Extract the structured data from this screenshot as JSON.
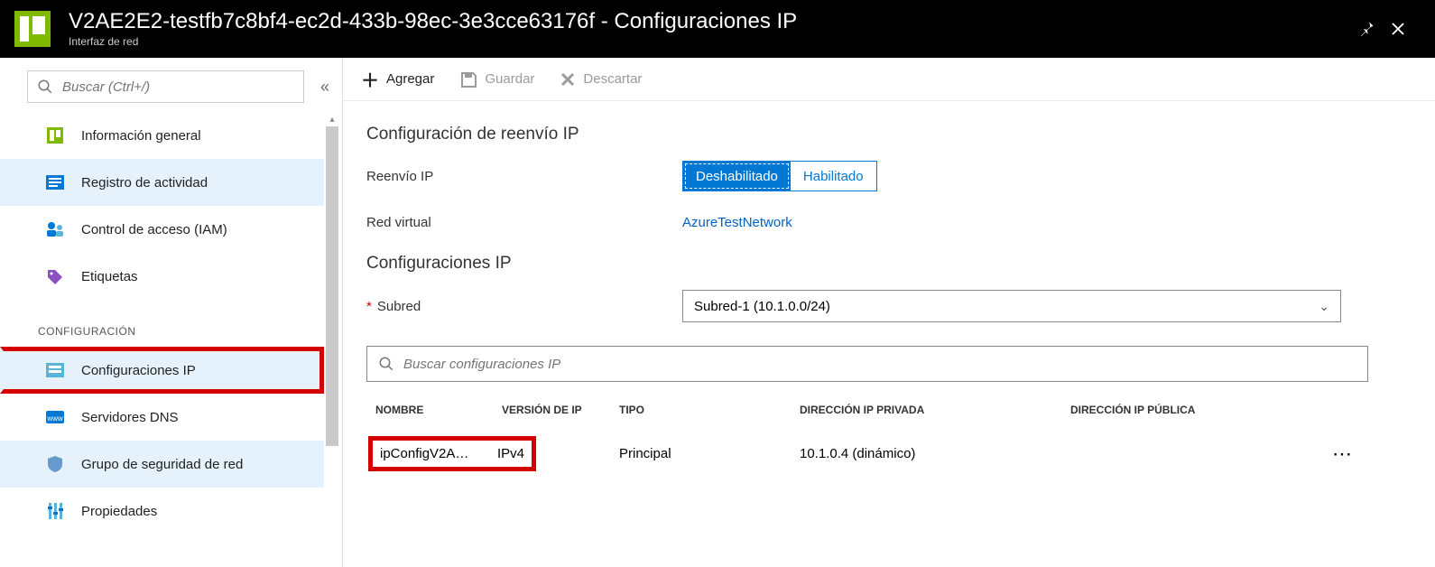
{
  "header": {
    "title": "V2AE2E2-testfb7c8bf4-ec2d-433b-98ec-3e3cce63176f - Configuraciones IP",
    "subtitle": "Interfaz de red"
  },
  "sidebar": {
    "search_placeholder": "Buscar (Ctrl+/)",
    "items_top": [
      {
        "label": "Información general"
      },
      {
        "label": "Registro de actividad"
      },
      {
        "label": "Control de acceso (IAM)"
      },
      {
        "label": "Etiquetas"
      }
    ],
    "section_label": "CONFIGURACIÓN",
    "items_cfg": [
      {
        "label": "Configuraciones IP"
      },
      {
        "label": "Servidores DNS"
      },
      {
        "label": "Grupo de seguridad de red"
      },
      {
        "label": "Propiedades"
      }
    ]
  },
  "toolbar": {
    "add": "Agregar",
    "save": "Guardar",
    "discard": "Descartar"
  },
  "ipfw": {
    "heading": "Configuración de reenvío IP",
    "label": "Reenvío IP",
    "disabled": "Deshabilitado",
    "enabled": "Habilitado",
    "vnet_label": "Red virtual",
    "vnet_value": "AzureTestNetwork"
  },
  "ipcfg": {
    "heading": "Configuraciones IP",
    "subnet_label": "Subred",
    "subnet_value": "Subred-1 (10.1.0.0/24)",
    "filter_placeholder": "Buscar configuraciones IP",
    "cols": {
      "name": "NOMBRE",
      "ver": "VERSIÓN DE IP",
      "type": "TIPO",
      "priv": "DIRECCIÓN IP PRIVADA",
      "pub": "DIRECCIÓN IP PÚBLICA"
    },
    "rows": [
      {
        "name": "ipConfigV2A…",
        "ver": "IPv4",
        "type": "Principal",
        "priv": "10.1.0.4 (dinámico)",
        "pub": ""
      }
    ]
  }
}
